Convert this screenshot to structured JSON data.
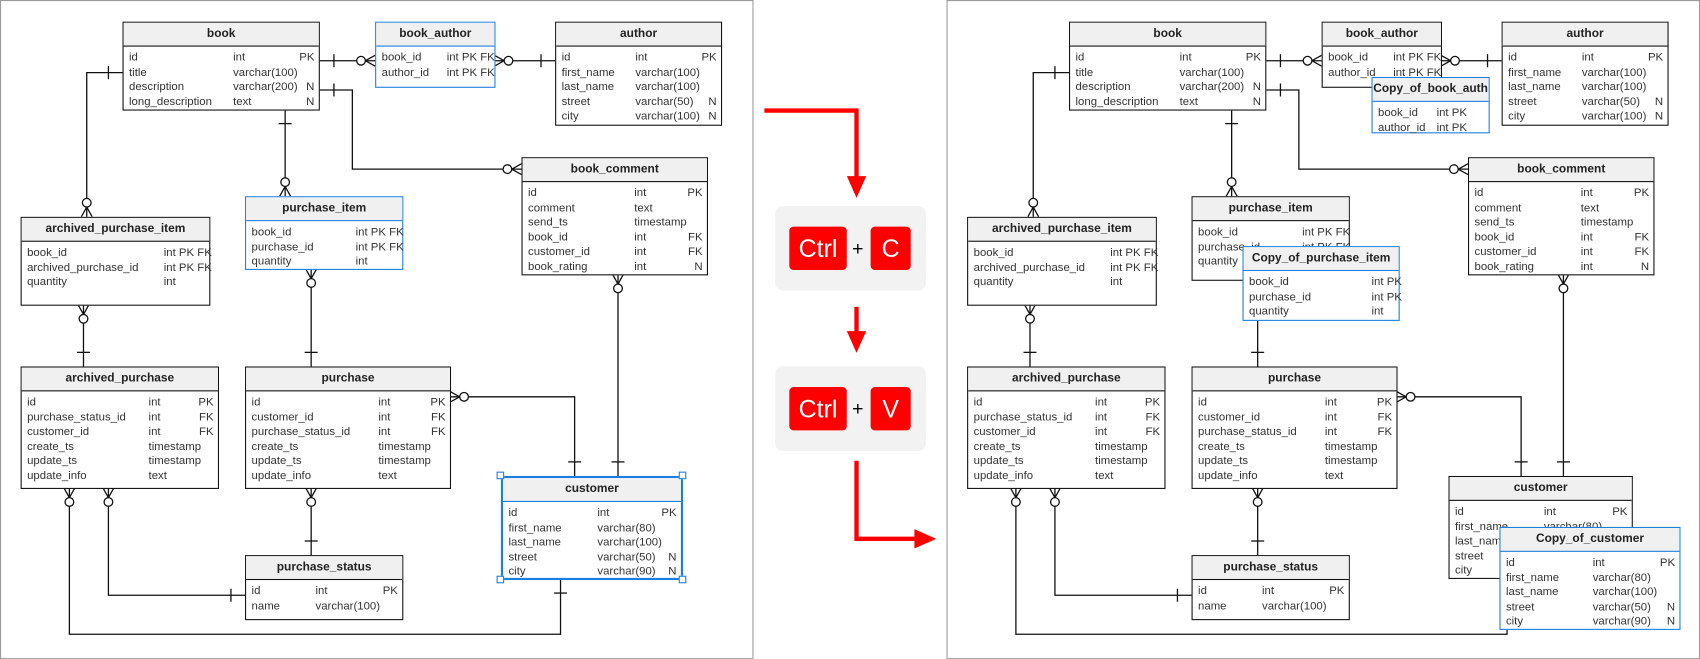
{
  "source_panel": {
    "selected_table": "customer",
    "tables": [
      {
        "id": "book",
        "name": "book",
        "rows": [
          [
            "id",
            "int",
            "PK"
          ],
          [
            "title",
            "varchar(100)",
            ""
          ],
          [
            "description",
            "varchar(200)",
            "N"
          ],
          [
            "long_description",
            "text",
            "N"
          ]
        ]
      },
      {
        "id": "book_author",
        "name": "book_author",
        "highlight": true,
        "rows": [
          [
            "book_id",
            "int PK FK",
            ""
          ],
          [
            "author_id",
            "int PK FK",
            ""
          ]
        ]
      },
      {
        "id": "author",
        "name": "author",
        "rows": [
          [
            "id",
            "int",
            "PK"
          ],
          [
            "first_name",
            "varchar(100)",
            ""
          ],
          [
            "last_name",
            "varchar(100)",
            ""
          ],
          [
            "street",
            "varchar(50)",
            "N"
          ],
          [
            "city",
            "varchar(100)",
            "N"
          ]
        ]
      },
      {
        "id": "book_comment",
        "name": "book_comment",
        "rows": [
          [
            "id",
            "int",
            "PK"
          ],
          [
            "comment",
            "text",
            ""
          ],
          [
            "send_ts",
            "timestamp",
            ""
          ],
          [
            "book_id",
            "int",
            "FK"
          ],
          [
            "customer_id",
            "int",
            "FK"
          ],
          [
            "book_rating",
            "int",
            "N"
          ]
        ]
      },
      {
        "id": "archived_purchase_item",
        "name": "archived_purchase_item",
        "rows": [
          [
            "book_id",
            "int PK FK",
            ""
          ],
          [
            "archived_purchase_id",
            "int PK FK",
            ""
          ],
          [
            "quantity",
            "int",
            ""
          ]
        ]
      },
      {
        "id": "purchase_item",
        "name": "purchase_item",
        "highlight": true,
        "rows": [
          [
            "book_id",
            "int PK FK",
            ""
          ],
          [
            "purchase_id",
            "int PK FK",
            ""
          ],
          [
            "quantity",
            "int",
            ""
          ]
        ]
      },
      {
        "id": "archived_purchase",
        "name": "archived_purchase",
        "rows": [
          [
            "id",
            "int",
            "PK"
          ],
          [
            "purchase_status_id",
            "int",
            "FK"
          ],
          [
            "customer_id",
            "int",
            "FK"
          ],
          [
            "create_ts",
            "timestamp",
            ""
          ],
          [
            "update_ts",
            "timestamp",
            ""
          ],
          [
            "update_info",
            "text",
            ""
          ]
        ]
      },
      {
        "id": "purchase",
        "name": "purchase",
        "rows": [
          [
            "id",
            "int",
            "PK"
          ],
          [
            "customer_id",
            "int",
            "FK"
          ],
          [
            "purchase_status_id",
            "int",
            "FK"
          ],
          [
            "create_ts",
            "timestamp",
            ""
          ],
          [
            "update_ts",
            "timestamp",
            ""
          ],
          [
            "update_info",
            "text",
            ""
          ]
        ]
      },
      {
        "id": "purchase_status",
        "name": "purchase_status",
        "rows": [
          [
            "id",
            "int",
            "PK"
          ],
          [
            "name",
            "varchar(100)",
            ""
          ]
        ]
      },
      {
        "id": "customer",
        "name": "customer",
        "rows": [
          [
            "id",
            "int",
            "PK"
          ],
          [
            "first_name",
            "varchar(80)",
            ""
          ],
          [
            "last_name",
            "varchar(100)",
            ""
          ],
          [
            "street",
            "varchar(50)",
            "N"
          ],
          [
            "city",
            "varchar(90)",
            "N"
          ]
        ]
      }
    ]
  },
  "result_panel": {
    "copies": [
      {
        "id": "copy_book_author",
        "name": "Copy_of_book_auth",
        "rows": [
          [
            "book_id",
            "int PK",
            ""
          ],
          [
            "author_id",
            "int PK",
            ""
          ]
        ]
      },
      {
        "id": "copy_purchase_item",
        "name": "Copy_of_purchase_item",
        "rows": [
          [
            "book_id",
            "int PK",
            ""
          ],
          [
            "purchase_id",
            "int PK",
            ""
          ],
          [
            "quantity",
            "int",
            ""
          ]
        ]
      },
      {
        "id": "copy_customer",
        "name": "Copy_of_customer",
        "rows": [
          [
            "id",
            "int",
            "PK"
          ],
          [
            "first_name",
            "varchar(80)",
            ""
          ],
          [
            "last_name",
            "varchar(100)",
            ""
          ],
          [
            "street",
            "varchar(50)",
            "N"
          ],
          [
            "city",
            "varchar(90)",
            "N"
          ]
        ]
      }
    ]
  },
  "shortcuts": {
    "copy": {
      "modifier": "Ctrl",
      "plus": "+",
      "key": "C"
    },
    "paste": {
      "modifier": "Ctrl",
      "plus": "+",
      "key": "V"
    }
  },
  "colors": {
    "accent_red": "#ff0000",
    "selection_blue": "#1a7fe0",
    "header_bg": "#f0f0f0"
  },
  "relationship_notation": "crows-foot"
}
